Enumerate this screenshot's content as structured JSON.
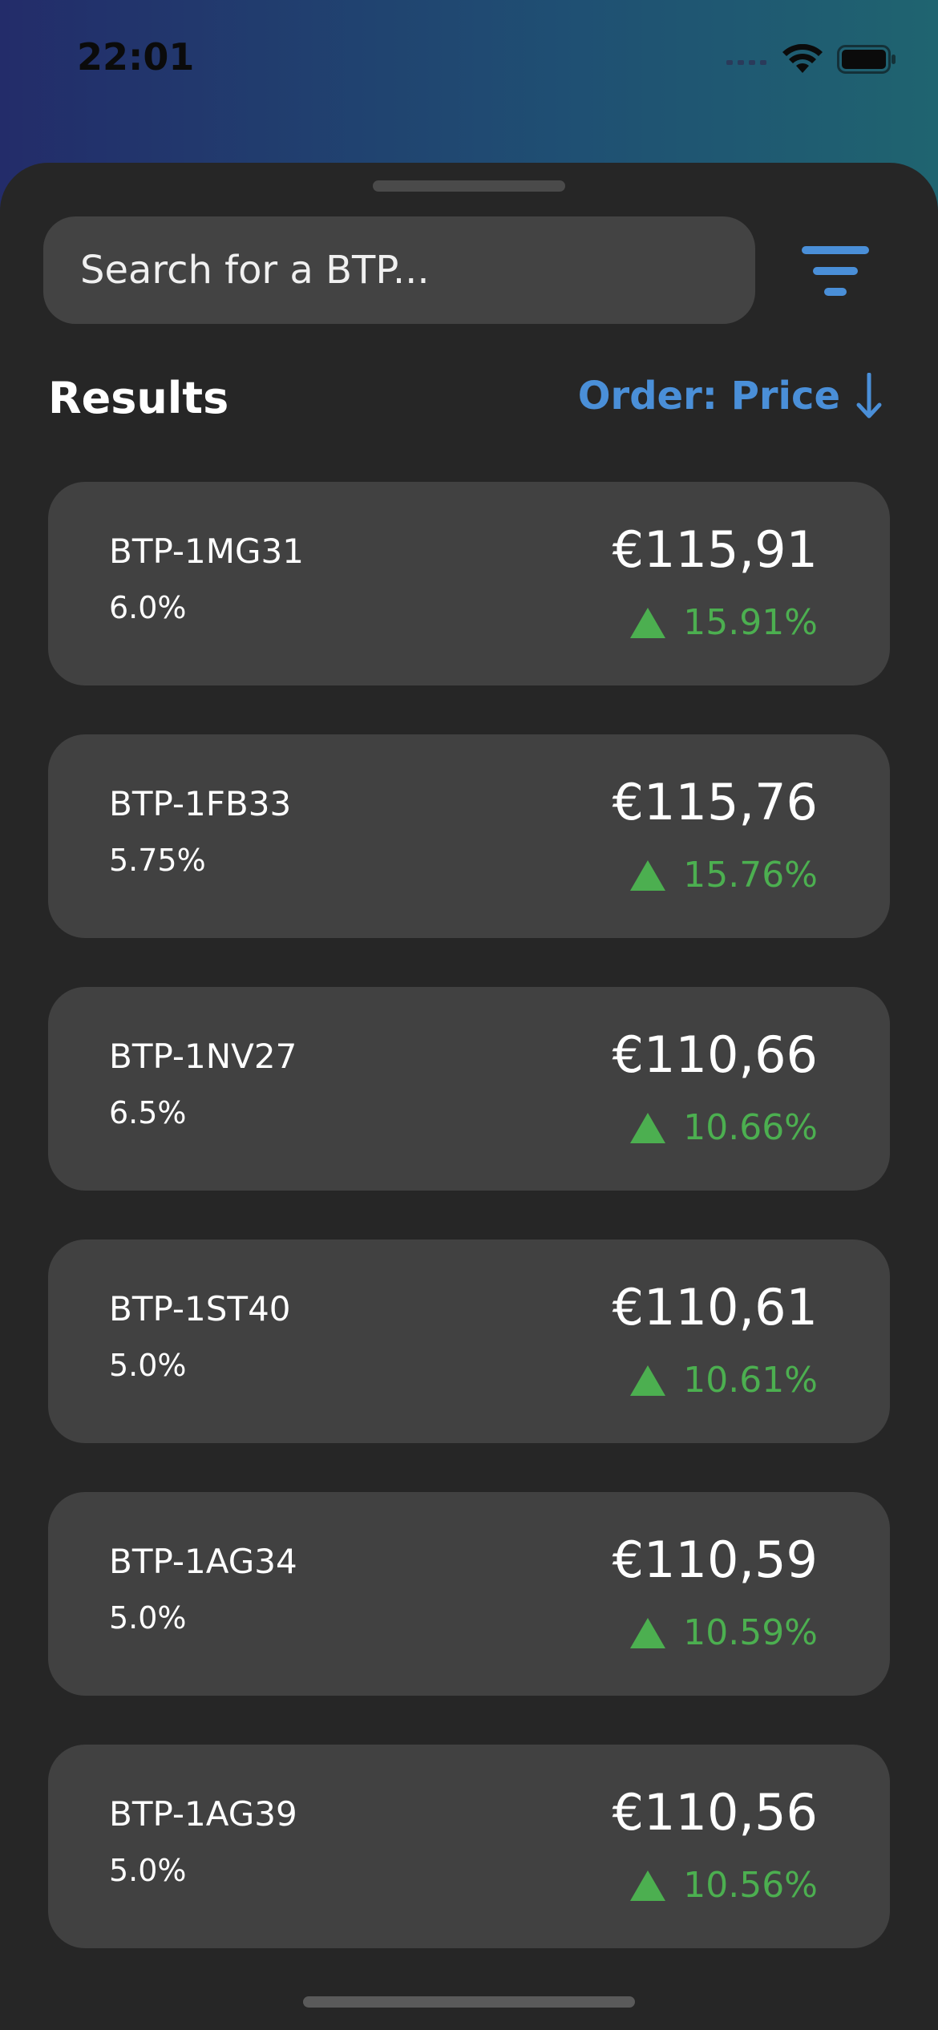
{
  "status_bar": {
    "time": "22:01"
  },
  "search": {
    "placeholder": "Search for a BTP..."
  },
  "results": {
    "title": "Results",
    "order_label": "Order: Price"
  },
  "colors": {
    "accent": "#4a8fd8",
    "positive": "#4caf50",
    "sheet_background": "#262626",
    "card_background": "#414141"
  },
  "icons": {
    "filter": "filter-icon",
    "order_direction": "arrow-down-icon",
    "change_indicator": "triangle-up-icon"
  },
  "bonds": [
    {
      "name": "BTP-1MG31",
      "rate": "6.0%",
      "price": "€115,91",
      "change": "15.91%"
    },
    {
      "name": "BTP-1FB33",
      "rate": "5.75%",
      "price": "€115,76",
      "change": "15.76%"
    },
    {
      "name": "BTP-1NV27",
      "rate": "6.5%",
      "price": "€110,66",
      "change": "10.66%"
    },
    {
      "name": "BTP-1ST40",
      "rate": "5.0%",
      "price": "€110,61",
      "change": "10.61%"
    },
    {
      "name": "BTP-1AG34",
      "rate": "5.0%",
      "price": "€110,59",
      "change": "10.59%"
    },
    {
      "name": "BTP-1AG39",
      "rate": "5.0%",
      "price": "€110,56",
      "change": "10.56%"
    }
  ]
}
